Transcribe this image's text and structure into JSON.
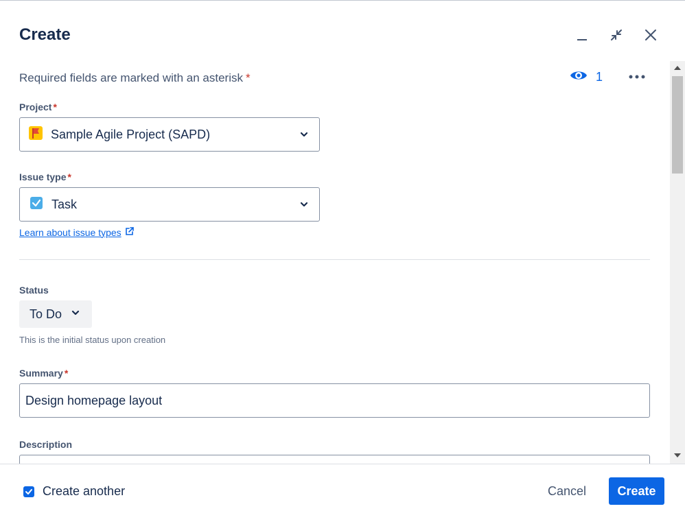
{
  "dialog": {
    "title": "Create",
    "minimize_icon": "minimize-icon",
    "collapse_icon": "collapse-icon",
    "close_icon": "close-icon"
  },
  "form": {
    "required_note": "Required fields are marked with an asterisk",
    "asterisk": "*",
    "watchers": {
      "icon": "eye-icon",
      "count": "1"
    },
    "more_icon": "more-icon",
    "project": {
      "label": "Project",
      "value": "Sample Agile Project (SAPD)",
      "icon": "project-flag-icon"
    },
    "issue_type": {
      "label": "Issue type",
      "value": "Task",
      "icon": "task-checkbox-icon"
    },
    "learn_link": "Learn about issue types",
    "status": {
      "label": "Status",
      "value": "To Do",
      "helper": "This is the initial status upon creation"
    },
    "summary": {
      "label": "Summary",
      "value": "Design homepage layout"
    },
    "description": {
      "label": "Description"
    }
  },
  "footer": {
    "create_another": "Create another",
    "cancel": "Cancel",
    "create": "Create"
  },
  "colors": {
    "primary": "#0C66E4",
    "required": "#C9372C",
    "text": "#172B4D",
    "subtle_text": "#44546F"
  }
}
